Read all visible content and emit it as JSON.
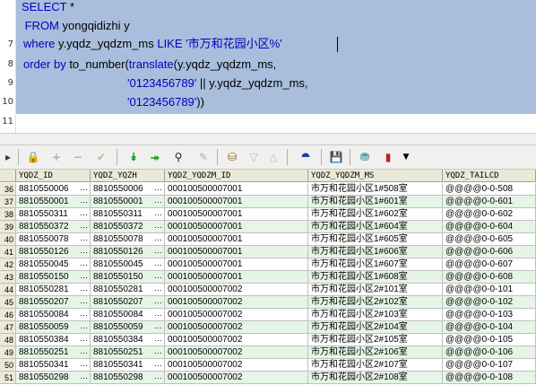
{
  "editor": {
    "line_numbers": [
      "7",
      "8",
      "9",
      "10",
      "11"
    ],
    "lines": [
      {
        "kw": "SELECT",
        "rest": " *"
      },
      {
        "kw": " FROM",
        "rest": " yongqidizhi y"
      },
      {
        "kw": "where",
        "rest": " y.yqdz_yqdzm_ms ",
        "kw2": "LIKE",
        "str": " '市万和花园小区%'"
      },
      {
        "kw": "order by",
        "rest": " to_number(",
        "fn": "translate",
        "rest2": "(y.yqdz_yqdzm_ms,"
      },
      {
        "str": "'0123456789'",
        "rest": " || y.yqdz_yqdzm_ms,"
      },
      {
        "str": "'0123456789'",
        "rest": "))"
      }
    ]
  },
  "toolbar": {
    "icons": [
      "menu-arrow-icon",
      "lock-icon",
      "add-icon",
      "remove-icon",
      "check-icon",
      "fetch-next-icon",
      "fetch-all-icon",
      "find-icon",
      "clear-icon",
      "query-icon",
      "filter-down-icon",
      "filter-up-icon",
      "tree-icon",
      "save-icon",
      "export-icon",
      "chart-icon",
      "dropdown-icon"
    ]
  },
  "grid": {
    "columns": [
      "YQDZ_ID",
      "YQDZ_YQZH",
      "YQDZ_YQDZM_ID",
      "YQDZ_YQDZM_MS",
      "YQDZ_TAILCD"
    ],
    "rows": [
      {
        "n": "36",
        "id": "8810550006",
        "yqzh": "8810550006",
        "mid": "000100500007001",
        "ms": "市万和花园小区1#508室",
        "tail": "@@@@0-0-508"
      },
      {
        "n": "37",
        "id": "8810550001",
        "yqzh": "8810550001",
        "mid": "000100500007001",
        "ms": "市万和花园小区1#601室",
        "tail": "@@@@0-0-601"
      },
      {
        "n": "38",
        "id": "8810550311",
        "yqzh": "8810550311",
        "mid": "000100500007001",
        "ms": "市万和花园小区1#602室",
        "tail": "@@@@0-0-602"
      },
      {
        "n": "39",
        "id": "8810550372",
        "yqzh": "8810550372",
        "mid": "000100500007001",
        "ms": "市万和花园小区1#604室",
        "tail": "@@@@0-0-604"
      },
      {
        "n": "40",
        "id": "8810550078",
        "yqzh": "8810550078",
        "mid": "000100500007001",
        "ms": "市万和花园小区1#605室",
        "tail": "@@@@0-0-605"
      },
      {
        "n": "41",
        "id": "8810550126",
        "yqzh": "8810550126",
        "mid": "000100500007001",
        "ms": "市万和花园小区1#606室",
        "tail": "@@@@0-0-606"
      },
      {
        "n": "42",
        "id": "8810550045",
        "yqzh": "8810550045",
        "mid": "000100500007001",
        "ms": "市万和花园小区1#607室",
        "tail": "@@@@0-0-607"
      },
      {
        "n": "43",
        "id": "8810550150",
        "yqzh": "8810550150",
        "mid": "000100500007001",
        "ms": "市万和花园小区1#608室",
        "tail": "@@@@0-0-608"
      },
      {
        "n": "44",
        "id": "8810550281",
        "yqzh": "8810550281",
        "mid": "000100500007002",
        "ms": "市万和花园小区2#101室",
        "tail": "@@@@0-0-101"
      },
      {
        "n": "45",
        "id": "8810550207",
        "yqzh": "8810550207",
        "mid": "000100500007002",
        "ms": "市万和花园小区2#102室",
        "tail": "@@@@0-0-102"
      },
      {
        "n": "46",
        "id": "8810550084",
        "yqzh": "8810550084",
        "mid": "000100500007002",
        "ms": "市万和花园小区2#103室",
        "tail": "@@@@0-0-103"
      },
      {
        "n": "47",
        "id": "8810550059",
        "yqzh": "8810550059",
        "mid": "000100500007002",
        "ms": "市万和花园小区2#104室",
        "tail": "@@@@0-0-104"
      },
      {
        "n": "48",
        "id": "8810550384",
        "yqzh": "8810550384",
        "mid": "000100500007002",
        "ms": "市万和花园小区2#105室",
        "tail": "@@@@0-0-105"
      },
      {
        "n": "49",
        "id": "8810550251",
        "yqzh": "8810550251",
        "mid": "000100500007002",
        "ms": "市万和花园小区2#106室",
        "tail": "@@@@0-0-106"
      },
      {
        "n": "50",
        "id": "8810550341",
        "yqzh": "8810550341",
        "mid": "000100500007002",
        "ms": "市万和花园小区2#107室",
        "tail": "@@@@0-0-107"
      },
      {
        "n": "51",
        "id": "8810550298",
        "yqzh": "8810550298",
        "mid": "000100500007002",
        "ms": "市万和花园小区2#108室",
        "tail": "@@@@0-0-108"
      }
    ],
    "ellipsis": "···"
  }
}
